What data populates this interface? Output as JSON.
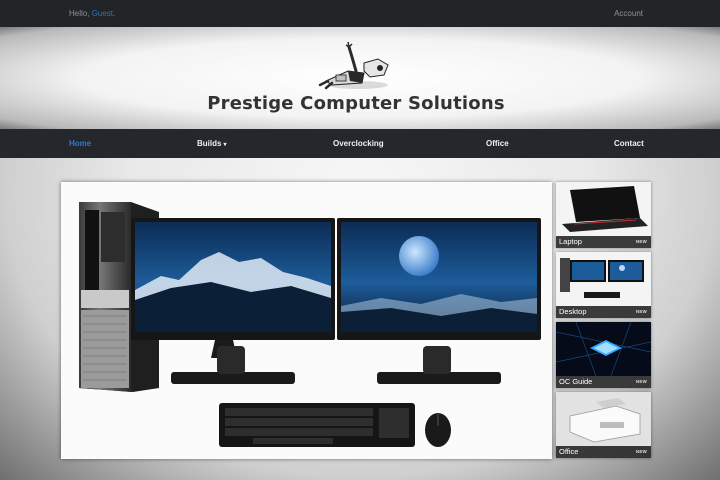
{
  "topbar": {
    "greeting": "Hello, ",
    "guest": "Guest",
    "punct": ".",
    "account": "Account"
  },
  "header": {
    "title": "Prestige Computer Solutions"
  },
  "nav": {
    "items": [
      {
        "label": "Home",
        "active": true
      },
      {
        "label": "Builds",
        "caret": "▾"
      },
      {
        "label": "Overclocking"
      },
      {
        "label": "Office"
      },
      {
        "label": "Contact"
      }
    ]
  },
  "thumbs": [
    {
      "label": "Laptop",
      "badge": "NEW"
    },
    {
      "label": "Desktop",
      "badge": "NEW"
    },
    {
      "label": "OC Guide",
      "badge": "NEW"
    },
    {
      "label": "Office",
      "badge": "NEW"
    }
  ],
  "colors": {
    "topbar": "#222528",
    "nav": "#24282c",
    "active_link": "#3a73c9",
    "guest_link": "#2b6fd0"
  }
}
